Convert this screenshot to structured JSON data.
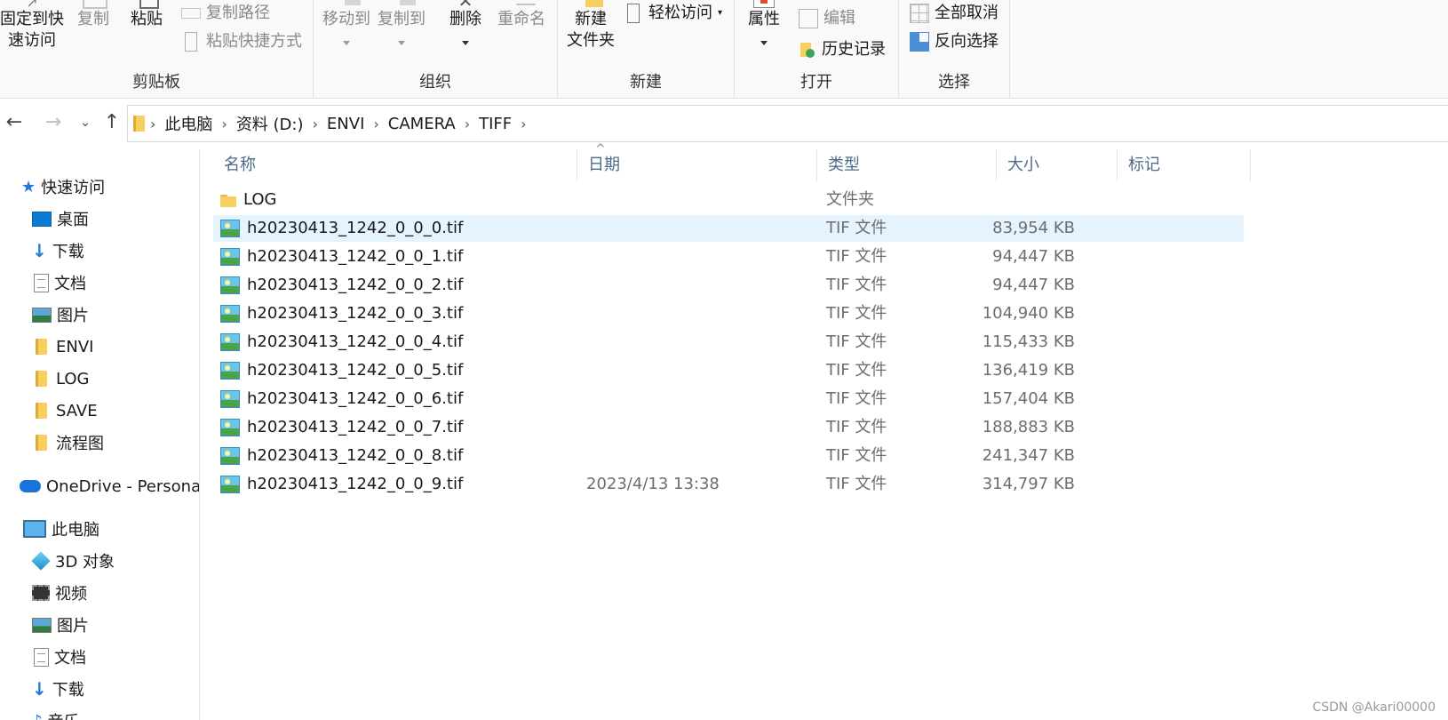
{
  "ribbon": {
    "clipboard": {
      "pin_label_1": "固定到快",
      "pin_label_2": "速访问",
      "copy": "复制",
      "paste": "粘贴",
      "copy_path": "复制路径",
      "paste_shortcut": "粘贴快捷方式",
      "group": "剪贴板"
    },
    "organize": {
      "move_to": "移动到",
      "copy_to": "复制到",
      "delete": "删除",
      "rename": "重命名",
      "group": "组织"
    },
    "new": {
      "new_folder_1": "新建",
      "new_folder_2": "文件夹",
      "easy_access": "轻松访问",
      "group": "新建"
    },
    "open": {
      "properties": "属性",
      "edit": "编辑",
      "history": "历史记录",
      "group": "打开"
    },
    "select": {
      "select_none": "全部取消",
      "invert": "反向选择",
      "group": "选择"
    }
  },
  "address": {
    "crumbs": [
      "此电脑",
      "资料 (D:)",
      "ENVI",
      "CAMERA",
      "TIFF"
    ]
  },
  "sidebar": {
    "quick_access": "快速访问",
    "items": [
      {
        "label": "桌面",
        "icon": "desktop-icon",
        "pinned": true
      },
      {
        "label": "下载",
        "icon": "download-icon",
        "pinned": true
      },
      {
        "label": "文档",
        "icon": "document-icon",
        "pinned": true
      },
      {
        "label": "图片",
        "icon": "picture-icon",
        "pinned": true
      },
      {
        "label": "ENVI",
        "icon": "folder-icon",
        "pinned": false
      },
      {
        "label": "LOG",
        "icon": "folder-icon",
        "pinned": false
      },
      {
        "label": "SAVE",
        "icon": "folder-icon",
        "pinned": false
      },
      {
        "label": "流程图",
        "icon": "folder-icon",
        "pinned": false
      }
    ],
    "onedrive": "OneDrive - Personal",
    "this_pc": "此电脑",
    "pc_items": [
      {
        "label": "3D 对象",
        "icon": "3d-objects-icon"
      },
      {
        "label": "视频",
        "icon": "video-icon"
      },
      {
        "label": "图片",
        "icon": "picture-icon"
      },
      {
        "label": "文档",
        "icon": "document-icon"
      },
      {
        "label": "下载",
        "icon": "download-icon"
      },
      {
        "label": "音乐",
        "icon": "music-icon"
      }
    ]
  },
  "columns": {
    "name": "名称",
    "date": "日期",
    "type": "类型",
    "size": "大小",
    "tags": "标记"
  },
  "files": [
    {
      "name": "LOG",
      "date": "",
      "type": "文件夹",
      "size": "",
      "icon": "folder-icon"
    },
    {
      "name": "h20230413_1242_0_0_0.tif",
      "date": "",
      "type": "TIF 文件",
      "size": "83,954 KB",
      "icon": "image-file-icon",
      "selected": true
    },
    {
      "name": "h20230413_1242_0_0_1.tif",
      "date": "",
      "type": "TIF 文件",
      "size": "94,447 KB",
      "icon": "image-file-icon"
    },
    {
      "name": "h20230413_1242_0_0_2.tif",
      "date": "",
      "type": "TIF 文件",
      "size": "94,447 KB",
      "icon": "image-file-icon"
    },
    {
      "name": "h20230413_1242_0_0_3.tif",
      "date": "",
      "type": "TIF 文件",
      "size": "104,940 KB",
      "icon": "image-file-icon"
    },
    {
      "name": "h20230413_1242_0_0_4.tif",
      "date": "",
      "type": "TIF 文件",
      "size": "115,433 KB",
      "icon": "image-file-icon"
    },
    {
      "name": "h20230413_1242_0_0_5.tif",
      "date": "",
      "type": "TIF 文件",
      "size": "136,419 KB",
      "icon": "image-file-icon"
    },
    {
      "name": "h20230413_1242_0_0_6.tif",
      "date": "",
      "type": "TIF 文件",
      "size": "157,404 KB",
      "icon": "image-file-icon"
    },
    {
      "name": "h20230413_1242_0_0_7.tif",
      "date": "",
      "type": "TIF 文件",
      "size": "188,883 KB",
      "icon": "image-file-icon"
    },
    {
      "name": "h20230413_1242_0_0_8.tif",
      "date": "",
      "type": "TIF 文件",
      "size": "241,347 KB",
      "icon": "image-file-icon"
    },
    {
      "name": "h20230413_1242_0_0_9.tif",
      "date": "2023/4/13 13:38",
      "type": "TIF 文件",
      "size": "314,797 KB",
      "icon": "image-file-icon"
    }
  ],
  "watermark": "CSDN @Akari00000",
  "colors": {
    "selection": "#e5f3ff",
    "header_text": "#4d6a8a",
    "accent": "#1e7ad6"
  }
}
